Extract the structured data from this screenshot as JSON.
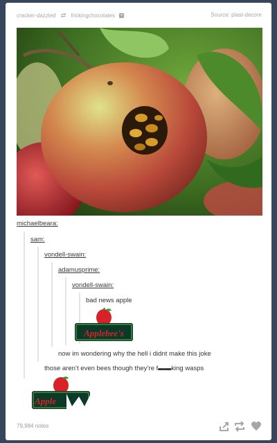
{
  "post": {
    "reblogger": "cracker-dazzled",
    "reblogged_from": "frickingchocolates",
    "source": "Source: plast-decore",
    "notes": "79,984 notes"
  },
  "chain": [
    {
      "user": "michaelbeara:"
    },
    {
      "user": "sam:"
    },
    {
      "user": "vondell-swain:"
    },
    {
      "user": "adamusprime:"
    },
    {
      "user": "vondell-swain:"
    },
    {
      "text": "bad news apple"
    },
    {
      "text": "now im wondering why the hell i didnt make this joke"
    },
    {
      "text": "those aren’t even bees though they’re f▬▬king wasps"
    }
  ],
  "logos": {
    "applebees": "Applebee's",
    "apple_cut": "Apple"
  },
  "icons": [
    "share-icon",
    "reblog-icon",
    "heart-icon"
  ],
  "colors": {
    "dashboard": "#36465d",
    "logo_green": "#0b3b28",
    "logo_red": "#d8222a"
  }
}
